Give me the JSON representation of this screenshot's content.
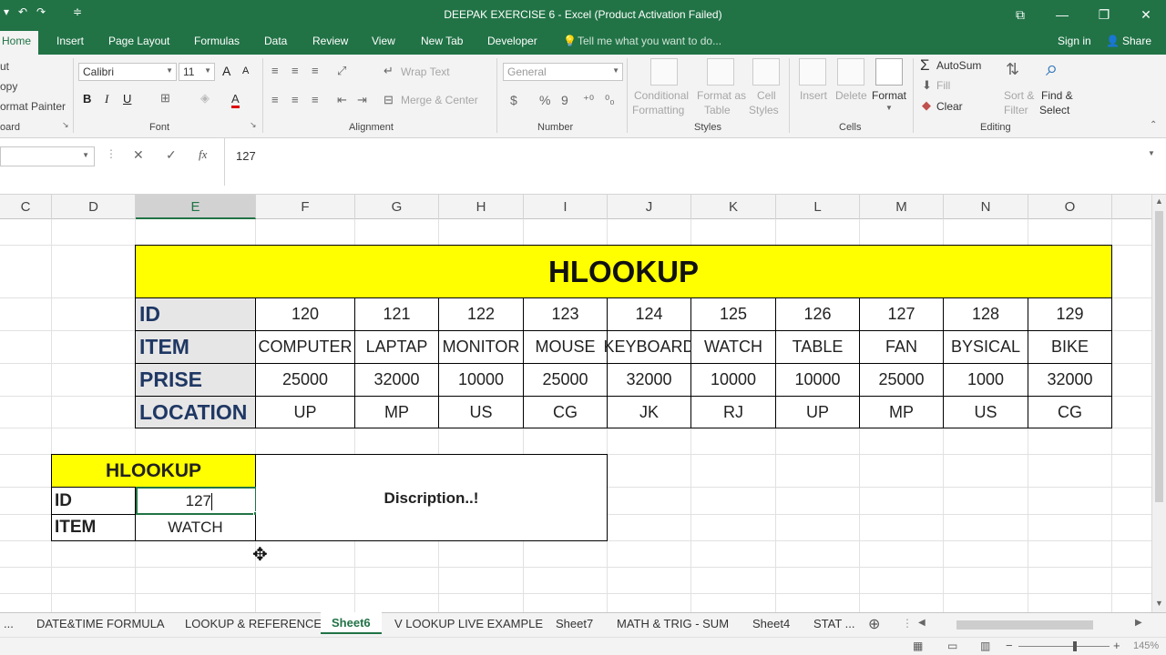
{
  "window": {
    "title": "DEEPAK EXERCISE 6 - Excel (Product Activation Failed)",
    "qa_save": "▾",
    "qa_undo": "↶",
    "qa_redo": "↷",
    "qa_more": "≑",
    "btn_ribbon": "⧉",
    "btn_min": "—",
    "btn_restore": "❐",
    "btn_close": "✕"
  },
  "ribbon_tabs": [
    "Home",
    "Insert",
    "Page Layout",
    "Formulas",
    "Data",
    "Review",
    "View",
    "New Tab",
    "Developer"
  ],
  "tell_me": "Tell me what you want to do...",
  "sign_in": "Sign in",
  "share": "Share",
  "clipboard": {
    "cut": "ut",
    "copy": "opy",
    "format_painter": "ormat Painter",
    "label": "oard"
  },
  "font": {
    "name": "Calibri",
    "size": "11",
    "bold": "B",
    "italic": "I",
    "underline": "U",
    "grow": "A",
    "shrink": "A",
    "label": "Font"
  },
  "alignment": {
    "wrap_text": "Wrap Text",
    "merge_center": "Merge & Center",
    "label": "Alignment"
  },
  "number": {
    "format": "General",
    "currency": "$",
    "percent": "%",
    "comma": "9",
    "label": "Number"
  },
  "styles": {
    "conditional_1": "Conditional",
    "conditional_2": "Formatting",
    "format_table_1": "Format as",
    "format_table_2": "Table",
    "cell_styles_1": "Cell",
    "cell_styles_2": "Styles",
    "label": "Styles"
  },
  "cells": {
    "insert": "Insert",
    "delete": "Delete",
    "format": "Format",
    "label": "Cells"
  },
  "editing": {
    "autosum": "AutoSum",
    "fill": "Fill",
    "clear": "Clear",
    "sort_1": "Sort &",
    "sort_2": "Filter",
    "find_1": "Find &",
    "find_2": "Select",
    "label": "Editing"
  },
  "formula_bar": {
    "cancel": "✕",
    "enter": "✓",
    "fx": "fx",
    "value": "127"
  },
  "columns": [
    "C",
    "D",
    "E",
    "F",
    "G",
    "H",
    "I",
    "J",
    "K",
    "L",
    "M",
    "N",
    "O"
  ],
  "table": {
    "title": "HLOOKUP",
    "rows": [
      {
        "header": "ID",
        "values": [
          "120",
          "121",
          "122",
          "123",
          "124",
          "125",
          "126",
          "127",
          "128",
          "129"
        ]
      },
      {
        "header": "ITEM",
        "values": [
          "COMPUTER",
          "LAPTAP",
          "MONITOR",
          "MOUSE",
          "KEYBOARD",
          "WATCH",
          "TABLE",
          "FAN",
          "BYSICAL",
          "BIKE"
        ]
      },
      {
        "header": "PRISE",
        "values": [
          "25000",
          "32000",
          "10000",
          "25000",
          "32000",
          "10000",
          "10000",
          "25000",
          "1000",
          "32000"
        ]
      },
      {
        "header": "LOCATION",
        "values": [
          "UP",
          "MP",
          "US",
          "CG",
          "JK",
          "RJ",
          "UP",
          "MP",
          "US",
          "CG"
        ]
      }
    ]
  },
  "lookup": {
    "title": "HLOOKUP",
    "id_label": "ID",
    "id_value": "127",
    "item_label": "ITEM",
    "item_value": "WATCH",
    "description": "Discription..!"
  },
  "sheet_tabs": [
    "...",
    "DATE&TIME FORMULA",
    "LOOKUP & REFERENCE",
    "Sheet6",
    "V LOOKUP LIVE EXAMPLE",
    "Sheet7",
    "MATH & TRIG - SUM",
    "Sheet4",
    "STAT ..."
  ],
  "status": {
    "zoom": "145%"
  },
  "colors": {
    "excel_green": "#217346",
    "title_fill": "#ffff00",
    "header_fill": "#e7e6e6",
    "header_text": "#1f3864"
  }
}
